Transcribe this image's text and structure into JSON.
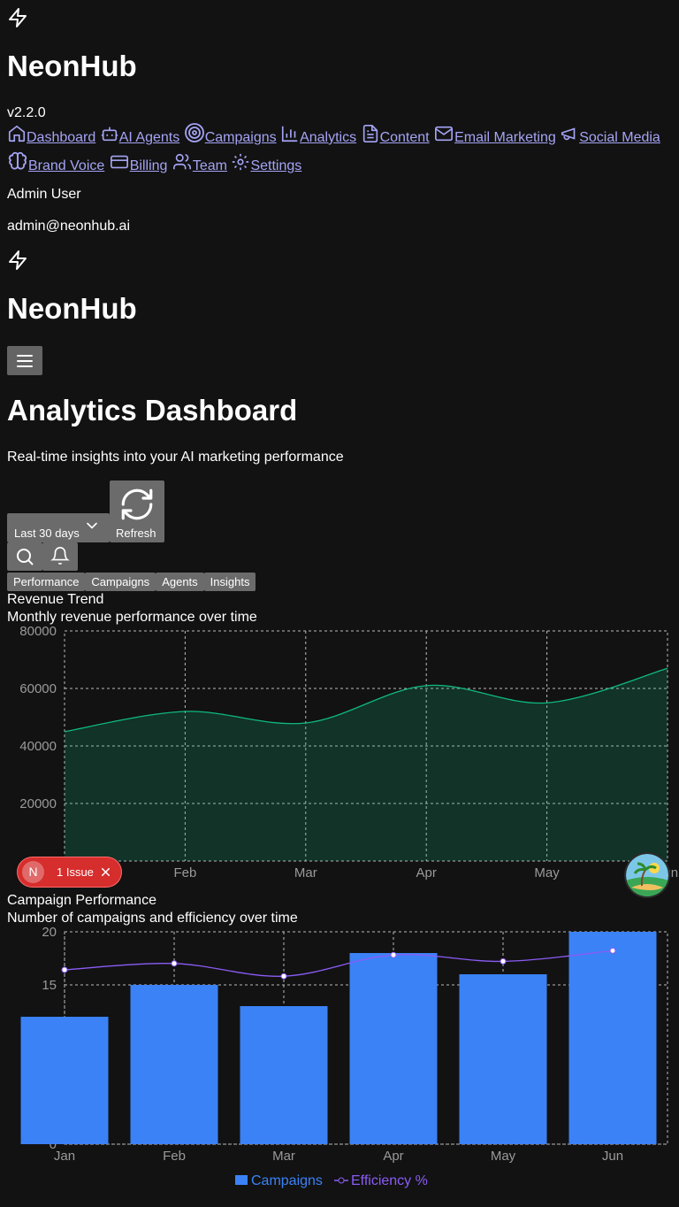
{
  "sidebar": {
    "brand": "NeonHub",
    "version": "v2.2.0",
    "nav": [
      {
        "label": "Dashboard",
        "icon": "home-icon"
      },
      {
        "label": "AI Agents",
        "icon": "bot-icon"
      },
      {
        "label": "Campaigns",
        "icon": "target-icon"
      },
      {
        "label": "Analytics",
        "icon": "bar-chart-icon"
      },
      {
        "label": "Content",
        "icon": "file-text-icon"
      },
      {
        "label": "Email Marketing",
        "icon": "mail-icon"
      },
      {
        "label": "Social Media",
        "icon": "megaphone-icon"
      },
      {
        "label": "Brand Voice",
        "icon": "brain-icon"
      },
      {
        "label": "Billing",
        "icon": "credit-card-icon"
      },
      {
        "label": "Team",
        "icon": "users-icon"
      },
      {
        "label": "Settings",
        "icon": "gear-icon"
      }
    ],
    "user_name": "Admin User",
    "user_email": "admin@neonhub.ai"
  },
  "header": {
    "brand": "NeonHub"
  },
  "main": {
    "title": "Analytics Dashboard",
    "subtitle": "Real-time insights into your AI marketing performance",
    "range_select": "Last 30 days",
    "refresh_label": "Refresh",
    "tabs": [
      "Performance",
      "Campaigns",
      "Agents",
      "Insights"
    ]
  },
  "issue_badge": {
    "avatar": "N",
    "label": "1 Issue"
  },
  "colors": {
    "revenue": "#10b981",
    "campaigns": "#3b82f6",
    "efficiency": "#8b5cf6"
  },
  "chart_data": [
    {
      "type": "area",
      "title": "Revenue Trend",
      "subtitle": "Monthly revenue performance over time",
      "categories": [
        "Jan",
        "Feb",
        "Mar",
        "Apr",
        "May",
        "Jun"
      ],
      "values": [
        45000,
        52000,
        48000,
        61000,
        55000,
        67000
      ],
      "yticks": [
        20000,
        40000,
        60000,
        80000
      ],
      "ylim": [
        0,
        80000
      ],
      "grid": true
    },
    {
      "type": "bar",
      "title": "Campaign Performance",
      "subtitle": "Number of campaigns and efficiency over time",
      "categories": [
        "Jan",
        "Feb",
        "Mar",
        "Apr",
        "May",
        "Jun"
      ],
      "series": [
        {
          "name": "Campaigns",
          "type": "bar",
          "values": [
            12,
            15,
            13,
            18,
            16,
            22
          ]
        },
        {
          "name": "Efficiency %",
          "type": "line",
          "values": [
            85,
            88,
            82,
            92,
            89,
            94
          ]
        }
      ],
      "yticks": [
        0,
        15,
        20
      ],
      "ylim": [
        0,
        20
      ],
      "legend": "bottom",
      "grid": true
    }
  ]
}
